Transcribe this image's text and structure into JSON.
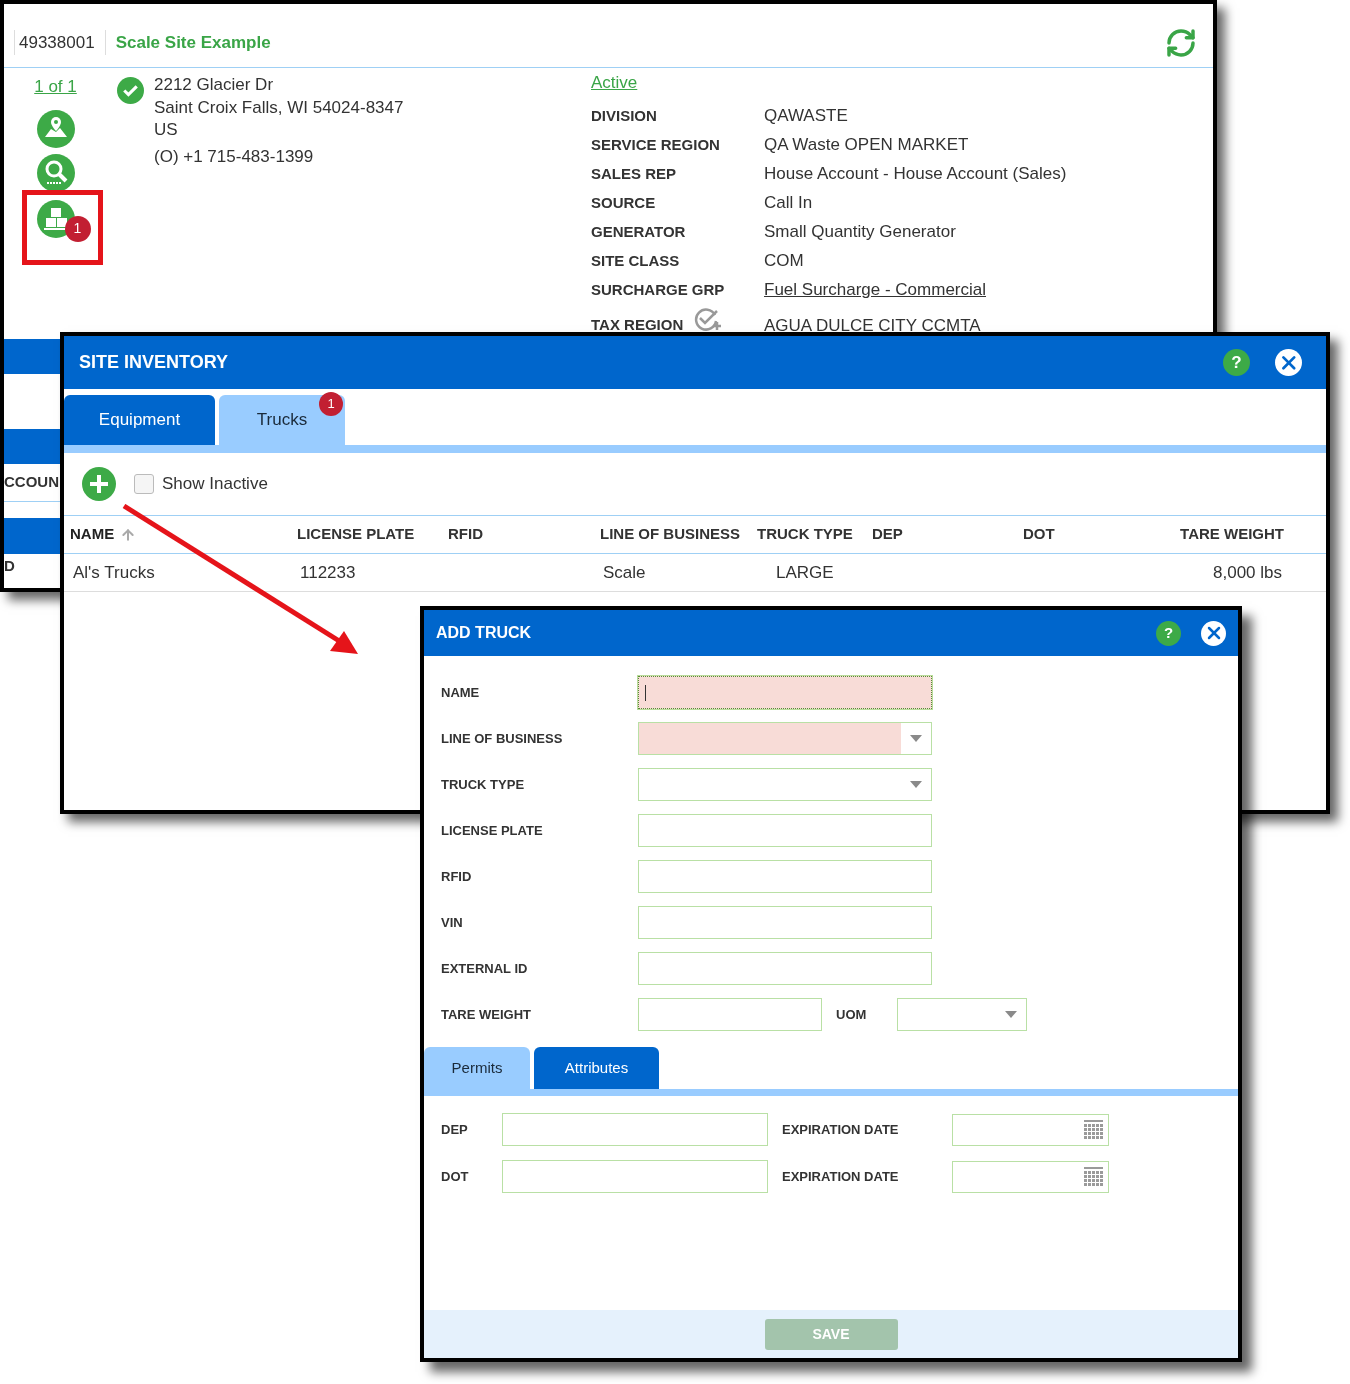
{
  "site_window": {
    "account_number": "49338001",
    "site_name": "Scale Site Example",
    "pager": "1 of 1",
    "inventory_badge": "1",
    "address_lines": [
      "2212 Glacier Dr",
      "Saint Croix Falls, WI 54024-8347",
      "US"
    ],
    "phone": "(O) +1 715-483-1399",
    "status": "Active",
    "details": [
      {
        "label": "DIVISION",
        "value": "QAWASTE",
        "kind": "text"
      },
      {
        "label": "SERVICE REGION",
        "value": "QA Waste OPEN MARKET",
        "kind": "text"
      },
      {
        "label": "SALES REP",
        "value": "House Account - House Account (Sales)",
        "kind": "text"
      },
      {
        "label": "SOURCE",
        "value": "Call In",
        "kind": "text"
      },
      {
        "label": "GENERATOR",
        "value": "Small Quantity Generator",
        "kind": "text"
      },
      {
        "label": "SITE CLASS",
        "value": "COM",
        "kind": "text"
      },
      {
        "label": "SURCHARGE GRP",
        "value": "Fuel Surcharge - Commercial",
        "kind": "link"
      },
      {
        "label": "TAX REGION",
        "value": "AGUA DULCE CITY CCMTA",
        "kind": "action"
      }
    ],
    "behind_texts": [
      "CCOUN",
      "D"
    ]
  },
  "inventory_window": {
    "title": "SITE INVENTORY",
    "help": "?",
    "tabs": [
      {
        "label": "Equipment",
        "selected": false
      },
      {
        "label": "Trucks",
        "selected": true,
        "badge": "1"
      }
    ],
    "show_inactive": {
      "label": "Show Inactive",
      "checked": false
    },
    "table": {
      "columns": [
        {
          "label": "NAME",
          "sorted": true
        },
        {
          "label": "LICENSE PLATE",
          "sorted": false
        },
        {
          "label": "RFID",
          "sorted": false
        },
        {
          "label": "LINE OF BUSINESS",
          "sorted": false
        },
        {
          "label": "TRUCK TYPE",
          "sorted": false
        },
        {
          "label": "DEP",
          "sorted": false
        },
        {
          "label": "DOT",
          "sorted": false
        },
        {
          "label": "TARE WEIGHT",
          "sorted": false
        }
      ],
      "rows": [
        [
          "Al's Trucks",
          "112233",
          "",
          "Scale",
          "LARGE",
          "",
          "",
          "8,000 lbs"
        ]
      ]
    }
  },
  "add_truck": {
    "title": "ADD TRUCK",
    "help": "?",
    "fields": [
      {
        "label": "NAME",
        "kind": "text",
        "required": true,
        "focused": true
      },
      {
        "label": "LINE OF BUSINESS",
        "kind": "select",
        "required": true,
        "focused": false
      },
      {
        "label": "TRUCK TYPE",
        "kind": "select",
        "required": false,
        "focused": false
      },
      {
        "label": "LICENSE PLATE",
        "kind": "text",
        "required": false,
        "focused": false
      },
      {
        "label": "RFID",
        "kind": "text",
        "required": false,
        "focused": false
      },
      {
        "label": "VIN",
        "kind": "text",
        "required": false,
        "focused": false
      },
      {
        "label": "EXTERNAL ID",
        "kind": "text",
        "required": false,
        "focused": false
      }
    ],
    "tare_weight": {
      "label": "TARE WEIGHT"
    },
    "uom": {
      "label": "UOM"
    },
    "tabs": [
      {
        "label": "Permits",
        "selected": true
      },
      {
        "label": "Attributes",
        "selected": false
      }
    ],
    "permits": [
      {
        "label": "DEP",
        "date_label": "EXPIRATION DATE"
      },
      {
        "label": "DOT",
        "date_label": "EXPIRATION DATE"
      }
    ],
    "save": {
      "label": "SAVE",
      "disabled": true
    }
  }
}
